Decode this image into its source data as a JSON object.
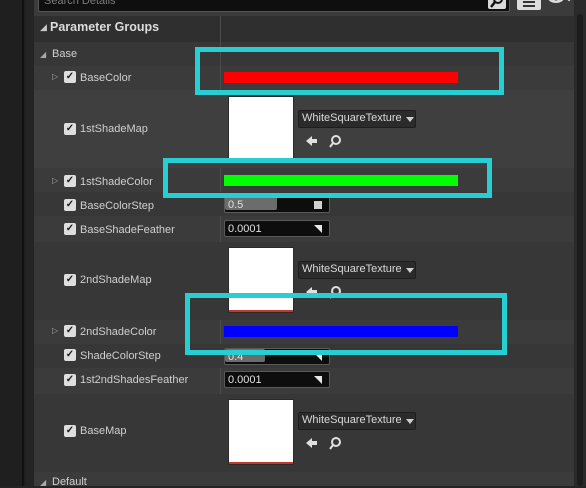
{
  "search": {
    "placeholder": "Search Details"
  },
  "section": {
    "title": "Parameter Groups",
    "subgroup": "Base",
    "next_subgroup": "Default"
  },
  "params": {
    "base_color": {
      "label": "BaseColor",
      "color": "#ff0000"
    },
    "first_shade_map": {
      "label": "1stShadeMap",
      "texture": "WhiteSquareTexture"
    },
    "first_shade_color": {
      "label": "1stShadeColor",
      "color": "#00ff00"
    },
    "base_color_step": {
      "label": "BaseColorStep",
      "value": "0.5"
    },
    "base_shade_feather": {
      "label": "BaseShadeFeather",
      "value": "0.0001"
    },
    "second_shade_map": {
      "label": "2ndShadeMap",
      "texture": "WhiteSquareTexture"
    },
    "second_shade_color": {
      "label": "2ndShadeColor",
      "color": "#0000ff"
    },
    "shade_color_step": {
      "label": "ShadeColorStep",
      "value": "0.4"
    },
    "first_second_shades_feather": {
      "label": "1st2ndShadesFeather",
      "value": "0.0001"
    },
    "base_map": {
      "label": "BaseMap",
      "texture": "WhiteSquareTexture"
    }
  },
  "highlight_color": "#27cfd3"
}
